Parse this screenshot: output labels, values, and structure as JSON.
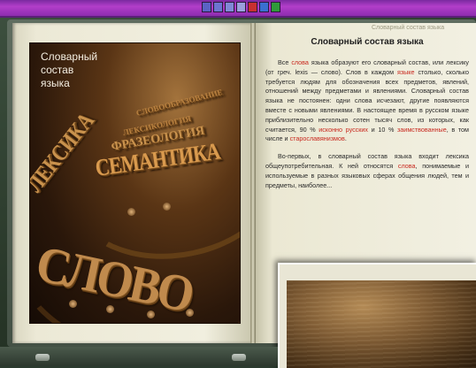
{
  "window": {
    "title": "Словарный состав языка",
    "toolbar_icons": [
      {
        "name": "bookmark-icon",
        "color": "#5a63c4"
      },
      {
        "name": "contents-icon",
        "color": "#6c74d0"
      },
      {
        "name": "search-icon",
        "color": "#8089d6"
      },
      {
        "name": "print-icon",
        "color": "#9aa0dd"
      },
      {
        "name": "flag-icon",
        "color": "#c83030"
      },
      {
        "name": "nav-icon",
        "color": "#3a6fd0"
      },
      {
        "name": "globe-icon",
        "color": "#2f9a3a"
      }
    ]
  },
  "book": {
    "cover": {
      "title": "Словарный\nсостав\nязыка",
      "words": [
        "СЛОВО",
        "СЕМАНТИКА",
        "ЛЕКСИКА",
        "ФРАЗЕОЛОГИЯ",
        "ЛЕКСИКОЛОГИЯ",
        "СЛОВООБРАЗОВАНИЕ"
      ]
    },
    "right_page": {
      "running_head": "Словарный состав языка",
      "title": "Словарный состав языка",
      "paragraph1": [
        {
          "t": "Все "
        },
        {
          "t": "слова",
          "hl": true
        },
        {
          "t": " языка образуют его словарный состав, или лексику (от греч. lexis — слово). Слов в каждом "
        },
        {
          "t": "языке",
          "hl": true
        },
        {
          "t": " столько, сколько требуется людям для обозначения всех предметов, явлений, отношений между предметами и явлениями. Словарный состав языка не постоянен: одни слова исчезают, другие появляются вместе с новыми явлениями. В настоящее время в русском языке приблизительно несколько сотен тысяч слов, из которых, как считается, 90 % "
        },
        {
          "t": "исконно русских",
          "hl": true
        },
        {
          "t": " и 10 % "
        },
        {
          "t": "заимствованные",
          "hl": true
        },
        {
          "t": ", в том числе и "
        },
        {
          "t": "старославянизмов",
          "hl": true
        },
        {
          "t": "."
        }
      ],
      "paragraph2": [
        {
          "t": "Во-первых, в словарный состав языка входит лексика общеупотребительная. К ней относятся "
        },
        {
          "t": "слова",
          "hl": true
        },
        {
          "t": ", понимаемые и используемые в разных языковых сферах общения людей, тем и предметы, наиболее..."
        }
      ]
    }
  }
}
